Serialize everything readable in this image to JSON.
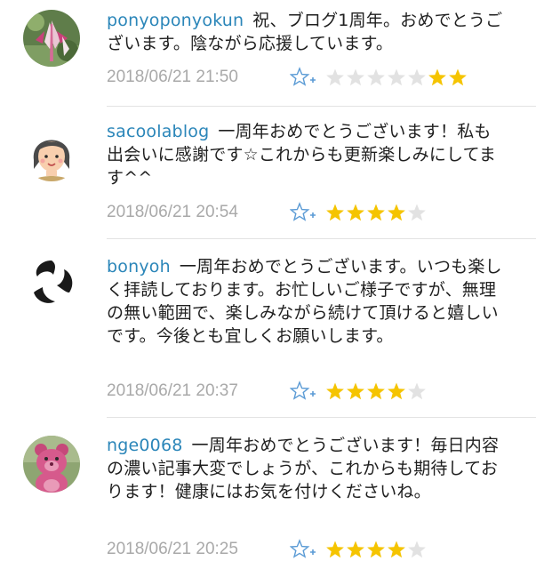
{
  "colors": {
    "username": "#2b86b9",
    "text": "#1f1f1f",
    "date": "#a9a9a9",
    "star_filled": "#f5c400",
    "star_empty": "#e2e2e2",
    "add_star": "#5b9bd5"
  },
  "comments": [
    {
      "username": "ponyoponyokun",
      "body": "祝、ブログ1周年。おめでとうございます。陰ながら応援しています。",
      "timestamp": "2018/06/21 21:50",
      "stars_filled": 2,
      "stars_total": 7,
      "stars_filled_last": true,
      "avatar": "flower-photo"
    },
    {
      "username": "sacoolablog",
      "body": "一周年おめでとうございます！私も出会いに感謝です☆これからも更新楽しみにしてます^^",
      "timestamp": "2018/06/21 20:54",
      "stars_filled": 4,
      "stars_total": 5,
      "stars_filled_last": false,
      "avatar": "cartoon-face"
    },
    {
      "username": "bonyoh",
      "body": "一周年おめでとうございます。いつも楽しく拝読しております。お忙しいご様子ですが、無理の無い範囲で、楽しみながら続けて頂けると嬉しいです。今後とも宜しくお願いします。",
      "timestamp": "2018/06/21 20:37",
      "stars_filled": 4,
      "stars_total": 5,
      "stars_filled_last": false,
      "avatar": "tomoe-symbol"
    },
    {
      "username": "nge0068",
      "body": "一周年おめでとうございます！毎日内容の濃い記事大変でしょうが、これからも期待しております！健康にはお気を付けくださいね。",
      "timestamp": "2018/06/21 20:25",
      "stars_filled": 4,
      "stars_total": 5,
      "stars_filled_last": false,
      "avatar": "pink-bear-toy"
    }
  ]
}
